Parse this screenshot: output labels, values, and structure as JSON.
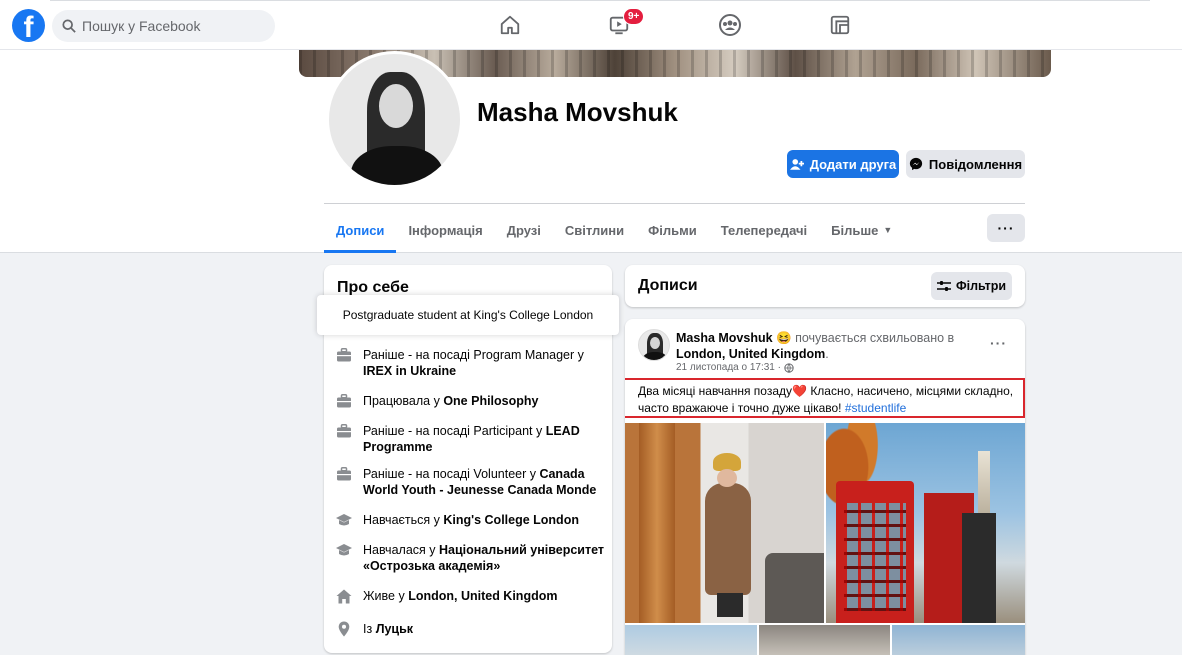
{
  "topbar": {
    "search_placeholder": "Пошук у Facebook",
    "video_badge": "9+",
    "logo_letter": "f",
    "nav_icons": [
      "home-icon",
      "watch-icon",
      "groups-icon",
      "gaming-icon"
    ]
  },
  "profile": {
    "name": "Masha Movshuk",
    "add_friend_label": "Додати друга",
    "message_label": "Повідомлення",
    "tabs": [
      {
        "label": "Дописи",
        "active": true
      },
      {
        "label": "Інформація"
      },
      {
        "label": "Друзі"
      },
      {
        "label": "Світлини"
      },
      {
        "label": "Фільми"
      },
      {
        "label": "Телепередачі"
      },
      {
        "label": "Більше"
      }
    ],
    "more_dots": "···"
  },
  "intro": {
    "title": "Про себе",
    "bio": "Postgraduate student at King's College London",
    "items": [
      {
        "icon": "briefcase-icon",
        "prefix": "Раніше - на посаді Program Manager у ",
        "bold": "IREX in Ukraine"
      },
      {
        "icon": "briefcase-icon",
        "prefix": "Працювала у ",
        "bold": "One Philosophy"
      },
      {
        "icon": "briefcase-icon",
        "prefix": "Раніше - на посаді Participant у ",
        "bold": "LEAD Programme"
      },
      {
        "icon": "briefcase-icon",
        "prefix": "Раніше - на посаді Volunteer у ",
        "bold": "Canada World Youth - Jeunesse Canada Monde"
      },
      {
        "icon": "graduation-cap-icon",
        "prefix": "Навчається у ",
        "bold": "King's College London"
      },
      {
        "icon": "graduation-cap-icon",
        "prefix": "Навчалася у ",
        "bold": "Національний університет «Острозька академія»"
      },
      {
        "icon": "home-icon",
        "prefix": "Живе у ",
        "bold": "London, United Kingdom"
      },
      {
        "icon": "location-pin-icon",
        "prefix": "Із ",
        "bold": "Луцьк"
      }
    ]
  },
  "posts": {
    "title": "Дописи",
    "filters_label": "Фільтри",
    "post": {
      "author": "Masha Movshuk",
      "feeling_emoji": "😆",
      "feeling_text": " почувається схвильовано в ",
      "location": "London, United Kingdom",
      "location_suffix": ".",
      "timestamp": "21 листопада о 17:31 · ",
      "visibility_icon": "globe-icon",
      "text_before_heart": "Два місяці навчання позаду",
      "heart": "❤️",
      "text_after_heart": " Класно, насичено, місцями складно, часто вражаюче і точно дуже цікаво! ",
      "hashtag": "#studentlife",
      "dots": "···"
    }
  },
  "colors": {
    "brand_blue": "#1877f2",
    "button_blue": "#1b74e4",
    "badge_red": "#e41e3f",
    "highlight_border": "#d9262d",
    "page_bg": "#f0f2f5"
  }
}
